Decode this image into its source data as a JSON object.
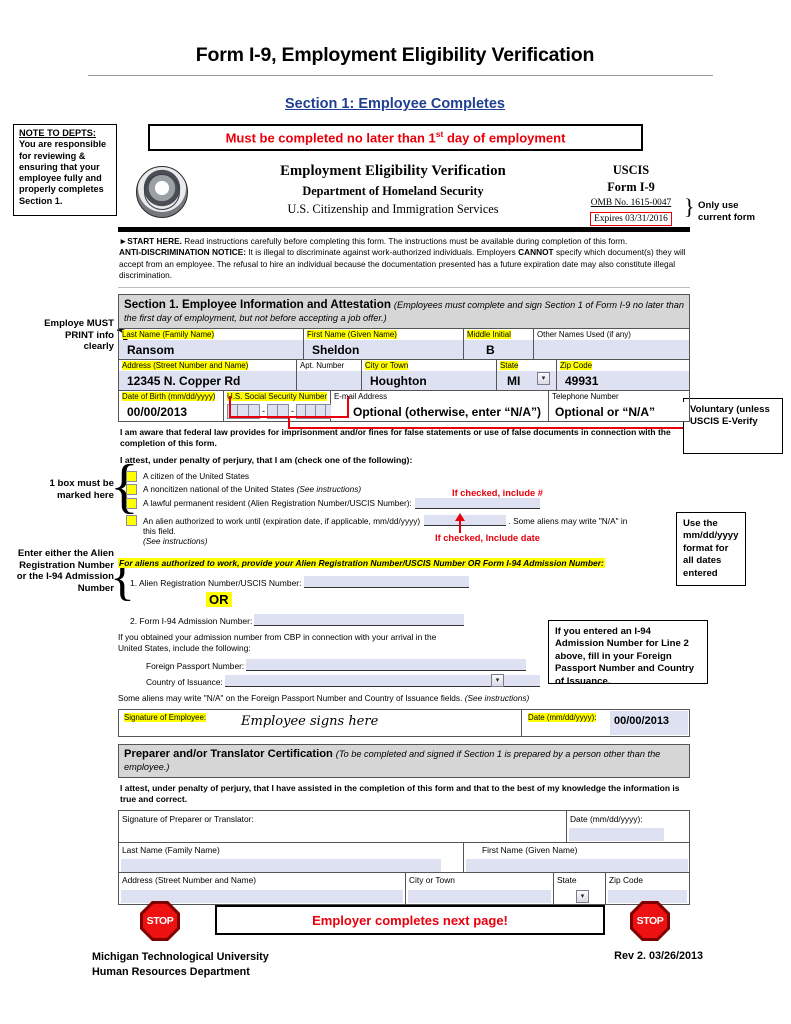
{
  "doc": {
    "title": "Form I-9, Employment Eligibility Verification",
    "section_heading": "Section 1: Employee Completes",
    "red_banner_pre": "Must be completed no later than 1",
    "red_banner_sup": "st",
    "red_banner_post": " day of employment",
    "employer_banner": "Employer completes next page!",
    "footer_left_line1": "Michigan Technological University",
    "footer_left_line2": "Human Resources Department",
    "footer_right": "Rev 2. 03/26/2013",
    "stop_label": "STOP"
  },
  "note_to_depts": {
    "heading": "NOTE TO DEPTS:",
    "body": "You are responsible for reviewing & ensuring that your employee fully and properly completes Section 1."
  },
  "annotations": {
    "only_use_current_form": "Only use current form",
    "employee_must_print": "Employe MUST PRINT info clearly",
    "one_box_must_be_marked": "1 box must be marked here",
    "enter_either_alien": "Enter either the Alien Registration Number or the I-94 Admission Number",
    "voluntary_box": "Voluntary (unless USCIS E-Verify",
    "use_mmddyyyy_box": "Use the mm/dd/yyyy format for all dates entered",
    "i94_passport_box": "If you entered an I-94 Admission Number for Line 2 above, fill in your Foreign Passport Number and Country of Issuance.",
    "if_checked_include_num": "If checked, include #",
    "if_checked_include_date": "If checked, Include date"
  },
  "form_header": {
    "title": "Employment Eligibility Verification",
    "agency": "Department of Homeland Security",
    "bureau": "U.S. Citizenship and Immigration Services",
    "uscis": "USCIS",
    "form_no": "Form I-9",
    "omb": "OMB No. 1615-0047",
    "expires": "Expires 03/31/2016"
  },
  "start_here": {
    "lead": "►START HERE.",
    "lead_rest": "  Read instructions carefully before completing this form. The instructions must be available during completion of this form.",
    "anti_label": "ANTI-DISCRIMINATION NOTICE:",
    "anti_body_1": "  It is illegal to discriminate against work-authorized individuals. Employers ",
    "anti_cannot": "CANNOT",
    "anti_body_2": " specify which document(s) they will accept from an employee. The refusal to hire an individual because the documentation presented has a future expiration date may also constitute illegal discrimination."
  },
  "section1": {
    "title": "Section 1. Employee Information and Attestation",
    "title_note": "(Employees must complete and sign Section 1 of Form I-9 no later than the first day of employment, but not before accepting a job offer.)",
    "labels": {
      "last_name": "Last Name (Family Name)",
      "first_name": "First Name (Given Name)",
      "middle_initial": "Middle Initial",
      "other_names": "Other Names Used (if any)",
      "address": "Address (Street Number and Name)",
      "apt": "Apt. Number",
      "city": "City or Town",
      "state": "State",
      "zip": "Zip Code",
      "dob": "Date of Birth (mm/dd/yyyy)",
      "ssn": "U.S. Social Security Number",
      "email": "E-mail Address",
      "phone": "Telephone Number"
    },
    "values": {
      "last_name": "Ransom",
      "first_name": "Sheldon",
      "middle_initial": "B",
      "other_names": "",
      "address": "12345 N. Copper Rd",
      "apt": "",
      "city": "Houghton",
      "state": "MI",
      "zip": "49931",
      "dob": "00/00/2013",
      "email": "Optional (otherwise, enter “N/A”)",
      "phone": "Optional or “N/A”"
    },
    "awareness": "I am aware that federal law provides for imprisonment and/or fines for false statements or use of false documents in connection with the completion of this form.",
    "attest_prompt": "I attest, under penalty of perjury, that I am (check one of the following):",
    "checkboxes": [
      {
        "label": "A citizen of the United States",
        "note": ""
      },
      {
        "label": "A noncitizen national of the United States ",
        "note": "(See instructions)"
      },
      {
        "label": "A lawful permanent resident (Alien Registration Number/USCIS Number):",
        "note": ""
      },
      {
        "label": "An alien authorized to work until (expiration date, if applicable, mm/dd/yyyy)",
        "note": ". Some aliens may write \"N/A\" in this field."
      }
    ],
    "checkbox4_sub": "(See instructions)",
    "alien_banner": "For aliens authorized to work, provide your Alien Registration Number/USCIS Number OR Form I-94 Admission Number:",
    "line1_label": "1. Alien Registration Number/USCIS Number:",
    "or_label": "OR",
    "line2_label": "2. Form I-94 Admission Number:",
    "cbp_text": "If you obtained your admission number from CBP in connection with your arrival in the United States, include the following:",
    "passport_label": "Foreign Passport Number:",
    "country_label": "Country of Issuance:",
    "na_note_1": "Some aliens may write \"N/A\" on the Foreign Passport Number and Country of Issuance fields. ",
    "na_note_2": "(See instructions)",
    "sig_label": "Signature of Employee:",
    "sig_value": "Employee signs here",
    "sig_date_label": "Date (mm/dd/yyyy):",
    "sig_date_value": "00/00/2013"
  },
  "preparer": {
    "title": "Preparer and/or Translator Certification",
    "title_note": "(To be completed and signed if Section 1 is prepared by a person other than the employee.)",
    "attest": "I attest, under penalty of perjury, that I have assisted in the completion of this form and that to the best of my knowledge the information is true and correct.",
    "labels": {
      "signature": "Signature of Preparer or Translator:",
      "date": "Date (mm/dd/yyyy):",
      "last_name": "Last Name (Family Name)",
      "first_name": "First Name (Given Name)",
      "address": "Address (Street Number and Name)",
      "city": "City or Town",
      "state": "State",
      "zip": "Zip Code"
    }
  },
  "colors": {
    "field_blue": "#dde1f2",
    "highlight_yellow": "#ffff00",
    "red": "#e8000d",
    "section_grey": "#d6d6d6",
    "heading_blue": "#1f3f93"
  }
}
